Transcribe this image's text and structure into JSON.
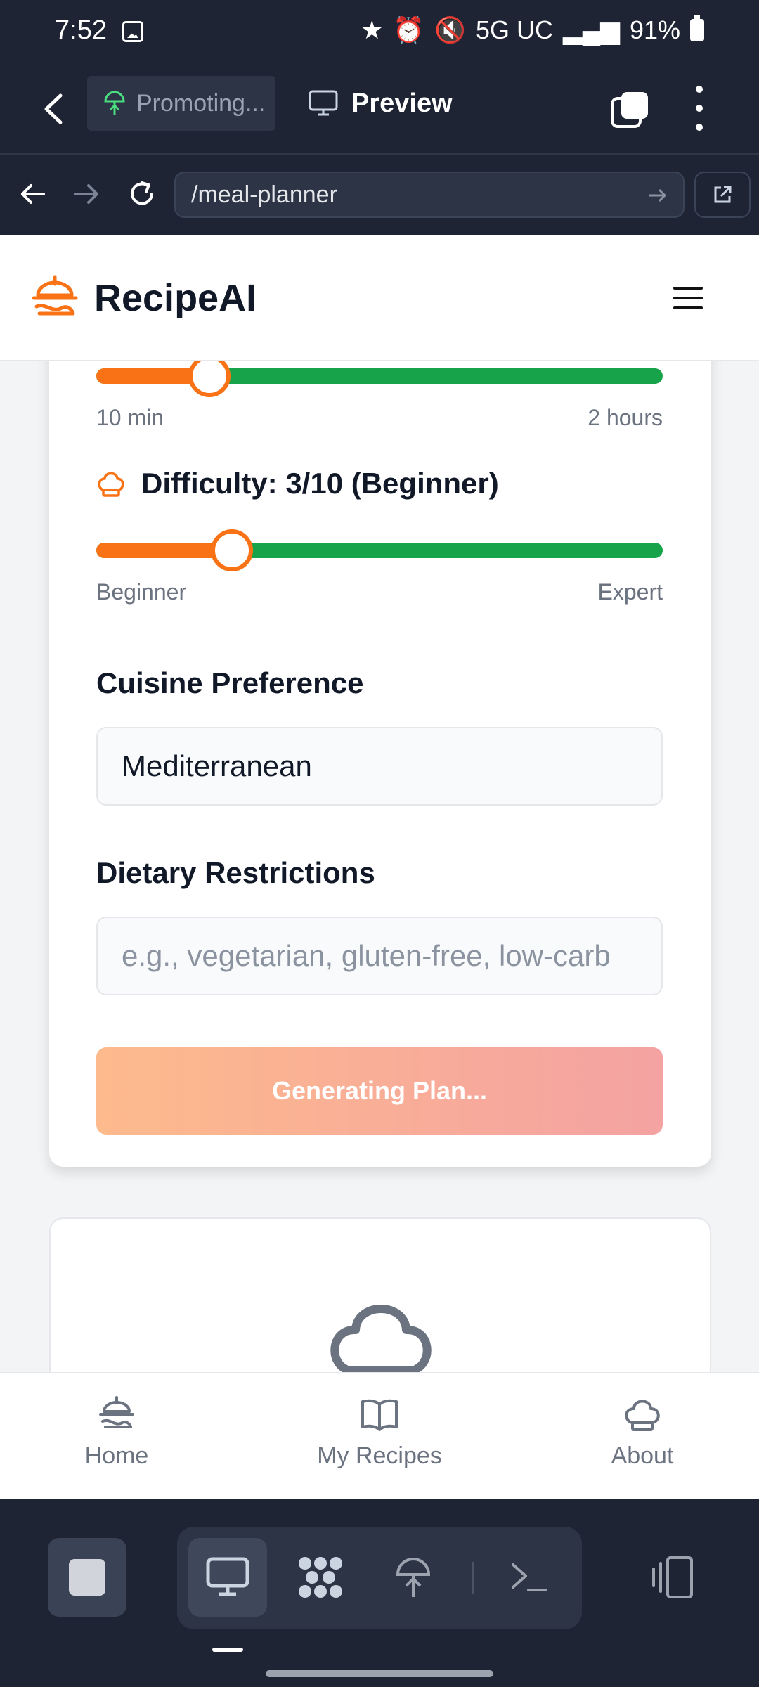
{
  "status_bar": {
    "time": "7:52",
    "network": "5G UC",
    "battery": "91%"
  },
  "browser": {
    "tab_label": "Promoting...",
    "preview_label": "Preview",
    "url": "/meal-planner"
  },
  "header": {
    "brand": "RecipeAI"
  },
  "planner": {
    "time_slider": {
      "min_label": "10 min",
      "max_label": "2 hours",
      "value_fraction": 0.2
    },
    "difficulty": {
      "title": "Difficulty: 3/10 (Beginner)",
      "min_label": "Beginner",
      "max_label": "Expert",
      "value_fraction": 0.24
    },
    "cuisine_label": "Cuisine Preference",
    "cuisine_value": "Mediterranean",
    "dietary_label": "Dietary Restrictions",
    "dietary_placeholder": "e.g., vegetarian, gluten-free, low-carb",
    "generate_button": "Generating Plan..."
  },
  "bottom_nav": [
    {
      "label": "Home"
    },
    {
      "label": "My Recipes"
    },
    {
      "label": "About"
    }
  ],
  "colors": {
    "accent": "#f97316",
    "track": "#16a34a",
    "chrome": "#1e2433"
  }
}
